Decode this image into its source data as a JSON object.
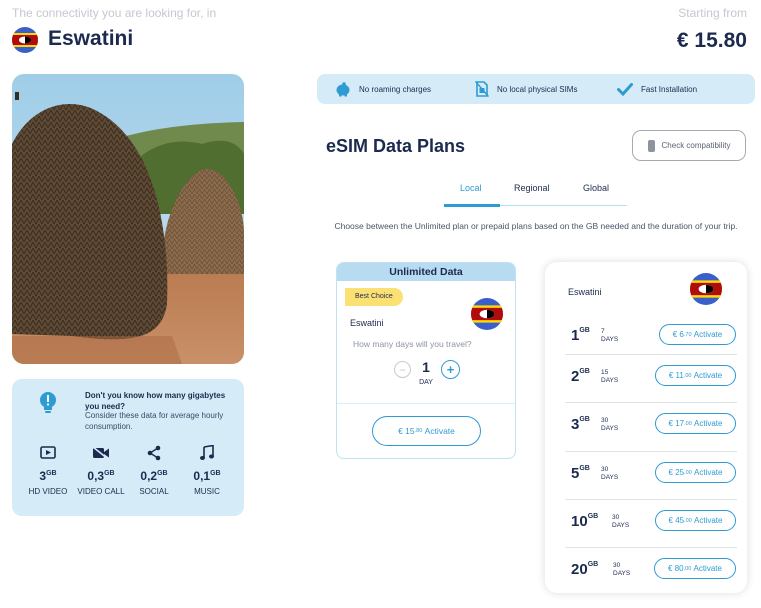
{
  "header": {
    "tagline": "The connectivity you are looking for, in",
    "country": "Eswatini",
    "starting_from_label": "Starting from",
    "starting_price": "€ 15.80"
  },
  "features": [
    {
      "icon": "piggy-bank-icon",
      "label": "No roaming charges"
    },
    {
      "icon": "no-sim-icon",
      "label": "No local physical SIMs"
    },
    {
      "icon": "checkmark-icon",
      "label": "Fast Installation"
    }
  ],
  "info_box": {
    "question": "Don't you know how many gigabytes you need?",
    "subtitle": "Consider these data for average hourly consumption.",
    "usage": [
      {
        "icon": "play-icon",
        "value": "3",
        "unit": "GB",
        "label": "HD VIDEO"
      },
      {
        "icon": "video-camera-icon",
        "value": "0,3",
        "unit": "GB",
        "label": "VIDEO CALL"
      },
      {
        "icon": "share-icon",
        "value": "0,2",
        "unit": "GB",
        "label": "SOCIAL"
      },
      {
        "icon": "music-note-icon",
        "value": "0,1",
        "unit": "GB",
        "label": "MUSIC"
      }
    ]
  },
  "plans": {
    "title": "eSIM Data Plans",
    "check_compat_label": "Check compatibility",
    "tabs": [
      "Local",
      "Regional",
      "Global"
    ],
    "active_tab": "Local",
    "description": "Choose between the Unlimited plan or prepaid plans based on the GB needed and the duration of your trip."
  },
  "unlimited": {
    "title": "Unlimited Data",
    "badge": "Best Choice",
    "country": "Eswatini",
    "question": "How many days will you travel?",
    "days_value": "1",
    "days_unit": "DAY",
    "minus_symbol": "−",
    "plus_symbol": "+",
    "price_main": "€ 15",
    "price_cents": ".80",
    "activate_label": "Activate"
  },
  "prepaid": {
    "country": "Eswatini",
    "days_label": "DAYS",
    "gb_unit": "GB",
    "activate_label": "Activate",
    "rows": [
      {
        "gb": "1",
        "days": "7",
        "price_main": "€ 6",
        "price_cents": ".70"
      },
      {
        "gb": "2",
        "days": "15",
        "price_main": "€ 11",
        "price_cents": ".00"
      },
      {
        "gb": "3",
        "days": "30",
        "price_main": "€ 17",
        "price_cents": ".00"
      },
      {
        "gb": "5",
        "days": "30",
        "price_main": "€ 25",
        "price_cents": ".00"
      },
      {
        "gb": "10",
        "days": "30",
        "price_main": "€ 45",
        "price_cents": ".00"
      },
      {
        "gb": "20",
        "days": "30",
        "price_main": "€ 80",
        "price_cents": ".00"
      }
    ]
  },
  "colors": {
    "accent": "#2e9bd3",
    "navy": "#1b2a4e",
    "light_blue_bg": "#d5ecf8",
    "badge_yellow": "#fbe073",
    "flag_blue": "#3a5fcd",
    "flag_red": "#b10c0c",
    "flag_yellow": "#ffd900"
  }
}
